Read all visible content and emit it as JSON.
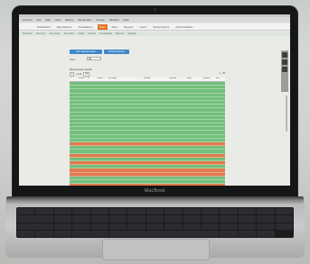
{
  "device": {
    "brand_label": "MacBook"
  },
  "browser": {
    "menu": [
      "Chrome",
      "File",
      "Edit",
      "View",
      "History",
      "Bookmarks",
      "People",
      "Window",
      "Help"
    ]
  },
  "app": {
    "nav": [
      "Dashboard",
      "Repositories",
      "Translations",
      "Tests",
      "Files",
      "Reports",
      "Users",
      "Subscriptions",
      "Administration"
    ],
    "active_nav_index": 3,
    "subnav": [
      "Overview",
      "Test runs",
      "Test cases",
      "Test plans",
      "Suites",
      "Results",
      "Translations",
      "Reports",
      "Settings"
    ],
    "buttons": {
      "run_selected": "Run selected tests",
      "refresh": "Refresh results"
    },
    "filter": {
      "label": "Filter",
      "value": "All"
    },
    "section_title": "Recent test results",
    "pager": {
      "page": "1",
      "of_label": "of 10",
      "per_page": "25",
      "records": "1 - 25"
    },
    "columns": [
      "#",
      "Status",
      "ID",
      "Project",
      "Test name",
      "Started",
      "Duration",
      "Build",
      "Runner",
      "Info"
    ],
    "row_status": [
      "ok",
      "ok",
      "ok",
      "ok",
      "ok",
      "ok",
      "ok",
      "ok",
      "ok",
      "ok",
      "ok",
      "ok",
      "ok",
      "ok",
      "ok",
      "ok",
      "fail",
      "ok",
      "ok",
      "fail",
      "ok",
      "fail",
      "ok",
      "fail",
      "fail",
      "ok",
      "ok",
      "fail",
      "fail",
      "ok",
      "fail",
      "fail",
      "fail",
      "ok",
      "ok",
      "ok",
      "ok",
      "ok"
    ],
    "colors": {
      "pass": "#73bf7c",
      "fail": "#e07a4d",
      "accent": "#e5742a",
      "button": "#3f86c7"
    }
  }
}
